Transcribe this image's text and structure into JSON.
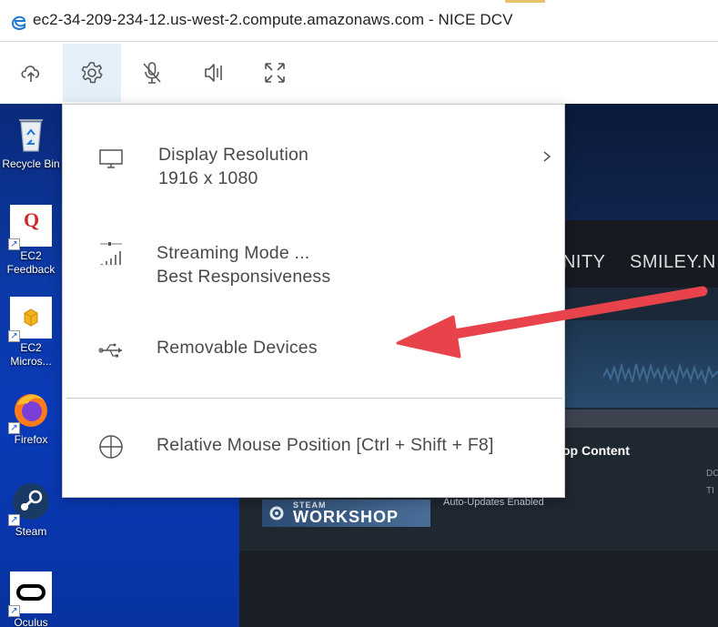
{
  "window": {
    "title": "ec2-34-209-234-12.us-west-2.compute.amazonaws.com - NICE DCV",
    "browser_icon": "edge-icon"
  },
  "toolbar": {
    "buttons": [
      {
        "name": "upload-cloud-icon"
      },
      {
        "name": "settings-gear-icon",
        "active": true
      },
      {
        "name": "microphone-muted-icon"
      },
      {
        "name": "speaker-icon"
      },
      {
        "name": "fullscreen-icon"
      }
    ]
  },
  "settings_menu": {
    "items": [
      {
        "label": "Display Resolution",
        "value": "1916 x 1080",
        "icon": "monitor-icon",
        "has_submenu": true
      },
      {
        "label": "Streaming Mode ...",
        "value": "Best Responsiveness",
        "icon": "signal-bars-icon"
      },
      {
        "label": "Removable Devices",
        "icon": "usb-icon"
      },
      {
        "label": "Relative Mouse Position [Ctrl + Shift + F8]",
        "icon": "crosshair-icon"
      }
    ]
  },
  "desktop": {
    "icons": [
      {
        "label": "Recycle Bin"
      },
      {
        "label": "EC2\nFeedback"
      },
      {
        "label": "EC2\nMicros..."
      },
      {
        "label": "Firefox"
      },
      {
        "label": "Steam"
      },
      {
        "label": "Oculus"
      }
    ]
  },
  "steam": {
    "nav_text_1": "UNITY",
    "nav_text_2": "SMILEY.N",
    "section_title": "op Content",
    "auto_updates": "Auto-Updates Enabled",
    "workshop_small": "STEAM",
    "workshop_big": "WORKSHOP",
    "side_text_1": "DC",
    "side_text_2": "TI"
  },
  "colors": {
    "annotation_arrow": "#e8434a",
    "toolbar_active_bg": "#e3f0f9",
    "desktop_blue": "#0c3aa8"
  }
}
